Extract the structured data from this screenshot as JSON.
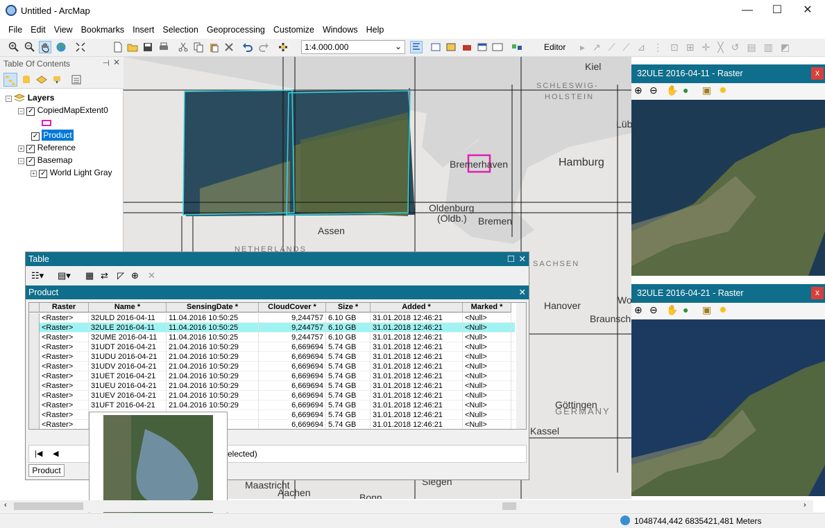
{
  "window": {
    "title": "Untitled - ArcMap",
    "min": "—",
    "max": "☐",
    "close": "✕"
  },
  "menu": [
    "File",
    "Edit",
    "View",
    "Bookmarks",
    "Insert",
    "Selection",
    "Geoprocessing",
    "Customize",
    "Windows",
    "Help"
  ],
  "toolbar": {
    "scale": "1:4.000.000",
    "editor": "Editor"
  },
  "toc": {
    "title": "Table Of Contents",
    "layers_label": "Layers",
    "items": [
      {
        "label": "CopiedMapExtent0",
        "checked": true
      },
      {
        "label": "Product",
        "checked": true
      },
      {
        "label": "Reference",
        "checked": true
      },
      {
        "label": "Basemap",
        "checked": true
      },
      {
        "label": "World Light Gray",
        "checked": true
      }
    ]
  },
  "map": {
    "labels": {
      "kiel": "Kiel",
      "schleswig": "SCHLESWIG-",
      "holstein": "HOLSTEIN",
      "lub": "Lüb",
      "bremerhaven": "Bremerhaven",
      "hamburg": "Hamburg",
      "oldenburg": "Oldenburg",
      "oldb": "(Oldb.)",
      "bremen": "Bremen",
      "assen": "Assen",
      "netherlands": "NETHERLANDS",
      "sachsen": "SACHSEN",
      "hanover": "Hanover",
      "wo": "Wo",
      "braunsch": "Braunsch",
      "goettingen": "Göttingen",
      "germany": "GERMANY",
      "kassel": "Kassel",
      "maastricht": "Maastricht",
      "aachen": "Aachen",
      "siegen": "Siegen",
      "bonn": "Bonn"
    }
  },
  "viewer1": {
    "title": "32ULE 2016-04-11 - Raster"
  },
  "viewer2": {
    "title": "32ULE 2016-04-21 - Raster"
  },
  "table": {
    "title": "Table",
    "tab_title": "Product",
    "columns": [
      "Raster",
      "Name *",
      "SensingDate *",
      "CloudCover *",
      "Size *",
      "Added *",
      "Marked *"
    ],
    "rows": [
      [
        "<Raster>",
        "32ULD 2016-04-11",
        "11.04.2016 10:50:25",
        "9,244757",
        "6.10 GB",
        "31.01.2018 12:46:21",
        "<Null>"
      ],
      [
        "<Raster>",
        "32ULE 2016-04-11",
        "11.04.2016 10:50:25",
        "9,244757",
        "6.10 GB",
        "31.01.2018 12:46:21",
        "<Null>"
      ],
      [
        "<Raster>",
        "32UME 2016-04-11",
        "11.04.2016 10:50:25",
        "9,244757",
        "6.10 GB",
        "31.01.2018 12:46:21",
        "<Null>"
      ],
      [
        "<Raster>",
        "31UDT 2016-04-21",
        "21.04.2016 10:50:29",
        "6,669694",
        "5.74 GB",
        "31.01.2018 12:46:21",
        "<Null>"
      ],
      [
        "<Raster>",
        "31UDU 2016-04-21",
        "21.04.2016 10:50:29",
        "6,669694",
        "5.74 GB",
        "31.01.2018 12:46:21",
        "<Null>"
      ],
      [
        "<Raster>",
        "31UDV 2016-04-21",
        "21.04.2016 10:50:29",
        "6,669694",
        "5.74 GB",
        "31.01.2018 12:46:21",
        "<Null>"
      ],
      [
        "<Raster>",
        "31UET 2016-04-21",
        "21.04.2016 10:50:29",
        "6,669694",
        "5.74 GB",
        "31.01.2018 12:46:21",
        "<Null>"
      ],
      [
        "<Raster>",
        "31UEU 2016-04-21",
        "21.04.2016 10:50:29",
        "6,669694",
        "5.74 GB",
        "31.01.2018 12:46:21",
        "<Null>"
      ],
      [
        "<Raster>",
        "31UEV 2016-04-21",
        "21.04.2016 10:50:29",
        "6,669694",
        "5.74 GB",
        "31.01.2018 12:46:21",
        "<Null>"
      ],
      [
        "<Raster>",
        "31UFT 2016-04-21",
        "21.04.2016 10:50:29",
        "6,669694",
        "5.74 GB",
        "31.01.2018 12:46:21",
        "<Null>"
      ],
      [
        "<Raster>",
        "",
        "29",
        "6,669694",
        "5.74 GB",
        "31.01.2018 12:46:21",
        "<Null>"
      ],
      [
        "<Raster>",
        "",
        "29",
        "6,669694",
        "5.74 GB",
        "31.01.2018 12:46:21",
        "<Null>"
      ]
    ],
    "selected_row": 1,
    "status_fragment": "elected)",
    "tab_label": "Product"
  },
  "status": {
    "coords": "1048744,442  6835421,481 Meters"
  },
  "colors": {
    "accent": "#0f6e8c",
    "selection": "#9ff3f3",
    "footprint": "#2fd7e0",
    "marker": "#e020b0"
  }
}
